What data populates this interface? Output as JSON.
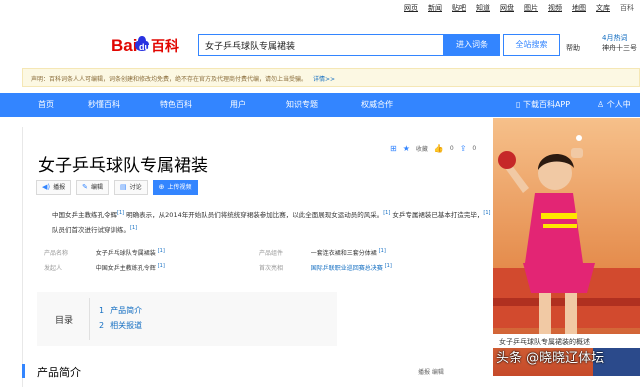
{
  "toplinks": [
    "网页",
    "新闻",
    "贴吧",
    "知道",
    "网盘",
    "图片",
    "视频",
    "地图",
    "文库",
    "百科"
  ],
  "header": {
    "logo_text": "Bai du 百科",
    "search_value": "女子乒乓球队专属裙装",
    "enter_button": "进入词条",
    "site_search_button": "全站搜索",
    "help": "帮助",
    "news_line1": "4月热词",
    "news_line2": "神舟十三号"
  },
  "notice": {
    "text": "声明：百科词条人人可编辑，词条创建和修改均免费，绝不存在官方及代理商付费代编，请勿上当受骗。",
    "detail": "详情>>"
  },
  "nav": {
    "items": [
      "首页",
      "秒懂百科",
      "特色百科",
      "用户",
      "知识专题",
      "权威合作"
    ],
    "download": "下载百科APP",
    "personal": "个人中"
  },
  "entry": {
    "title": "女子乒乓球队专属裙装",
    "collect": "收藏",
    "like_count": "0",
    "share_count": "0",
    "actions": [
      "播报",
      "编辑",
      "讨论",
      "上传视频"
    ],
    "summary_1": "中国女乒主教练孔令辉",
    "summary_ref1": "[1]",
    "summary_2": "明确表示，从2014年开始队员们将统统穿裙装参加比赛，以此全面展现女运动员的风采。",
    "summary_ref2": "[1]",
    "summary_3": "女乒专属裙装已基本打造完毕，",
    "summary_ref3": "[1]",
    "summary_4": "队员们首次进行试穿训练。",
    "summary_ref4": "[1]"
  },
  "infobox": {
    "rows": [
      {
        "k1": "产品名称",
        "v1": "女子乒乓球队专属裙装",
        "r1": "[1]",
        "k2": "产品组件",
        "v2": "一套连衣裙和三套分体裙",
        "r2": "[1]"
      },
      {
        "k1": "发起人",
        "v1": "中国女乒主教练孔令辉",
        "r1": "[1]",
        "k2": "首次亮相",
        "v2": "国际乒联职业巡回赛总决赛",
        "r2": "[1]"
      }
    ]
  },
  "toc": {
    "title": "目录",
    "items": [
      {
        "num": "1",
        "label": "产品简介"
      },
      {
        "num": "2",
        "label": "相关报道"
      }
    ]
  },
  "section": {
    "title": "产品简介",
    "tools": "播报   编辑"
  },
  "photo": {
    "caption": "女子乒乓球队专属裙装的概述",
    "watermark": "头条 @晓晓辽体坛"
  },
  "colors": {
    "brand": "#3385ff",
    "link": "#136ec2"
  }
}
